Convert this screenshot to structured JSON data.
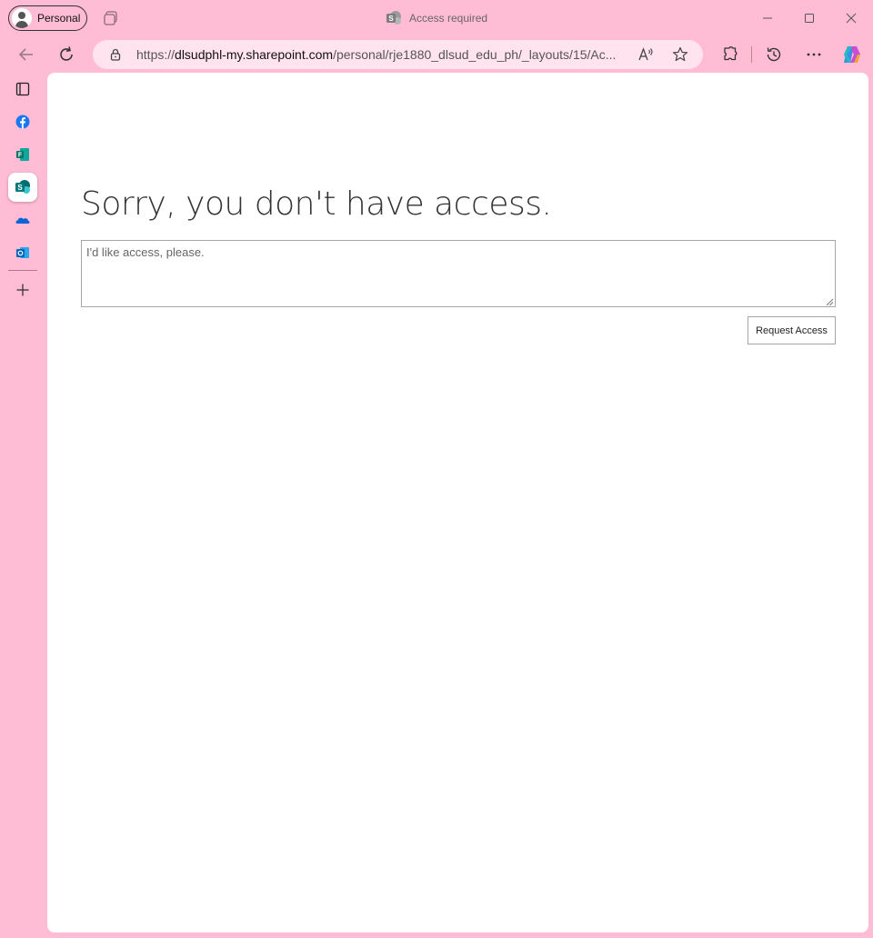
{
  "browser": {
    "profile_label": "Personal",
    "tab_title": "Access required",
    "url_prefix": "https://",
    "url_host": "dlsudphl-my.sharepoint.com",
    "url_path": "/personal/rje1880_dlsud_edu_ph/_layouts/15/Ac..."
  },
  "sidebar": {
    "items": [
      {
        "name": "tab-actions"
      },
      {
        "name": "facebook"
      },
      {
        "name": "forms"
      },
      {
        "name": "sharepoint",
        "active": true
      },
      {
        "name": "onedrive"
      },
      {
        "name": "outlook"
      }
    ]
  },
  "page": {
    "heading": "Sorry, you don't have access.",
    "message_placeholder": "I'd like access, please.",
    "request_button": "Request Access"
  },
  "colors": {
    "frame": "#ffbcd4",
    "address_bar": "#ffe3ee",
    "content_bg": "#ffffff"
  }
}
